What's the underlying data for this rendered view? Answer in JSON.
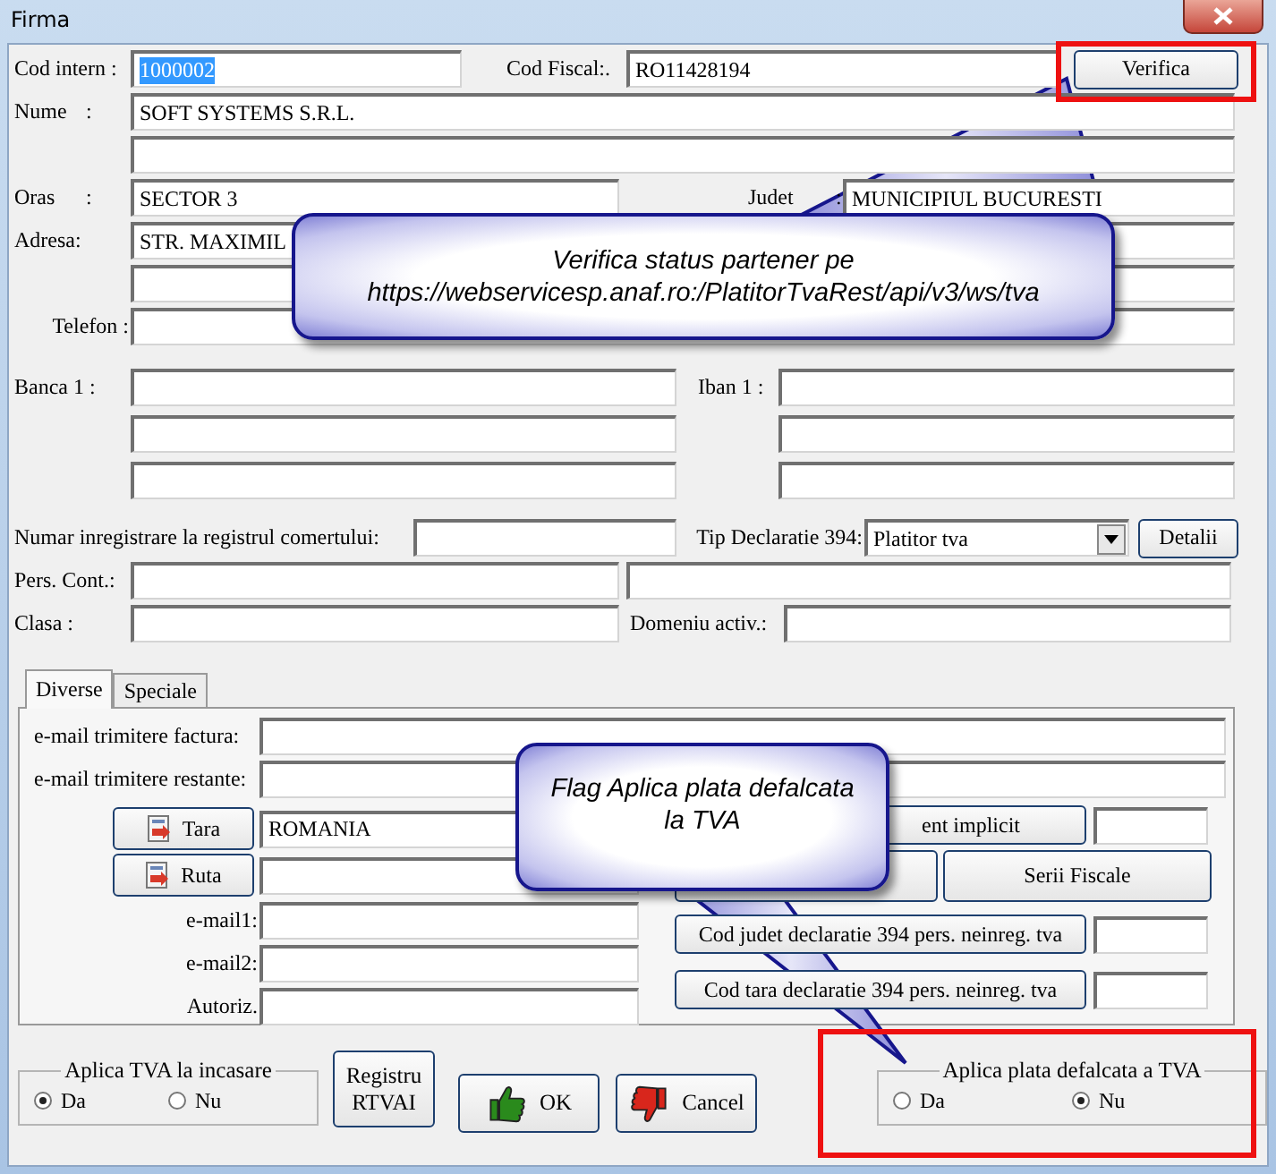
{
  "window": {
    "title": "Firma"
  },
  "form": {
    "cod_intern": {
      "label": "Cod intern :",
      "value": "1000002",
      "selected": true
    },
    "cod_fiscal": {
      "label": "Cod Fiscal:.",
      "value": "RO11428194"
    },
    "verify_button": "Verifica",
    "nume": {
      "label": "Nume",
      "colon": ":",
      "value": "SOFT SYSTEMS S.R.L."
    },
    "oras": {
      "label": "Oras",
      "colon": ":",
      "value": "SECTOR 3"
    },
    "judet": {
      "label": "Judet",
      "colon": ":",
      "value": "MUNICIPIUL BUCURESTI"
    },
    "adresa": {
      "label": "Adresa:",
      "value": "STR. MAXIMIL"
    },
    "telefon": {
      "label": "Telefon :"
    },
    "banca": {
      "label": "Banca 1 :"
    },
    "iban": {
      "label": "Iban 1 :"
    },
    "nr_reg_com": {
      "label": "Numar inregistrare la registrul comertului:"
    },
    "tip_declaratie": {
      "label": "Tip Declaratie 394:",
      "value": "Platitor tva"
    },
    "details_button": "Detalii",
    "pers_cont": {
      "label": "Pers. Cont.:"
    },
    "clasa": {
      "label": "Clasa  :"
    },
    "domeniu": {
      "label": "Domeniu activ.:"
    }
  },
  "tabs": [
    {
      "label": "Diverse",
      "selected": true
    },
    {
      "label": "Speciale",
      "selected": false
    }
  ],
  "diverse": {
    "email_factura": "e-mail trimitere factura:",
    "email_restante": "e-mail trimitere restante:",
    "tara": {
      "button": "Tara",
      "value": "ROMANIA"
    },
    "ruta": {
      "button": "Ruta"
    },
    "email1": "e-mail1:",
    "email2": "e-mail2:",
    "autoriz": "Autoriz.",
    "implicit_button": "ent implicit",
    "serii_button": "Serii Fiscale",
    "cod_judet_button": "Cod judet declaratie 394 pers. neinreg. tva",
    "cod_tara_button": "Cod tara declaratie 394 pers. neinreg. tva"
  },
  "bottom": {
    "tva_incasare": {
      "title": "Aplica TVA la incasare",
      "options": [
        {
          "label": "Da",
          "selected": true
        },
        {
          "label": "Nu",
          "selected": false
        }
      ]
    },
    "registru_button": "Registru RTVAI",
    "ok_button": "OK",
    "cancel_button": "Cancel",
    "plata_defalcata": {
      "title": "Aplica plata defalcata a TVA",
      "options": [
        {
          "label": "Da",
          "selected": false
        },
        {
          "label": "Nu",
          "selected": true
        }
      ]
    }
  },
  "callouts": [
    {
      "lines": [
        "Verifica status partener pe",
        "https://webservicesp.anaf.ro:/PlatitorTvaRest/api/v3/ws/tva"
      ]
    },
    {
      "lines": [
        "Flag Aplica plata defalcata",
        "la TVA"
      ]
    }
  ]
}
